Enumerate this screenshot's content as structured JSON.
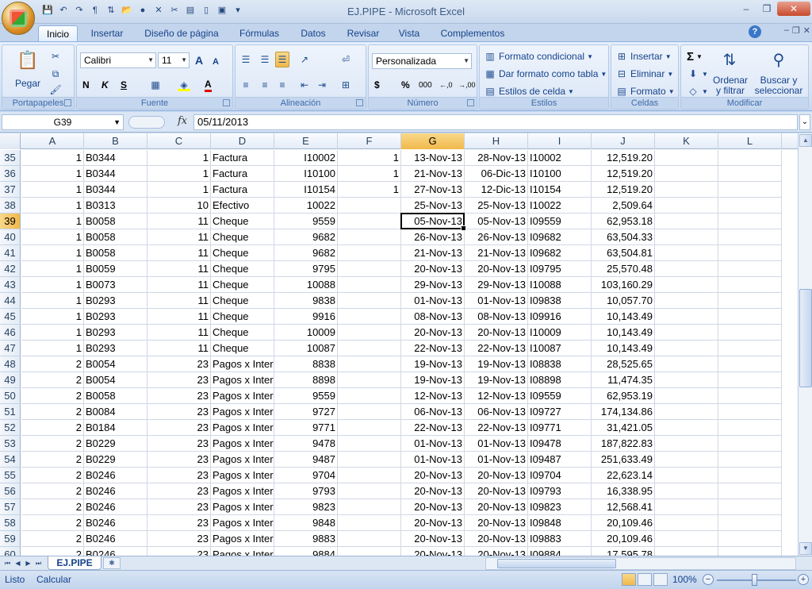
{
  "window": {
    "title": "EJ.PIPE - Microsoft Excel",
    "min": "–",
    "max": "❐",
    "close": "✕"
  },
  "ribbon_tabs": [
    "Inicio",
    "Insertar",
    "Diseño de página",
    "Fórmulas",
    "Datos",
    "Revisar",
    "Vista",
    "Complementos"
  ],
  "ribbon": {
    "clipboard": {
      "label": "Portapapeles",
      "paste": "Pegar"
    },
    "font": {
      "label": "Fuente",
      "name": "Calibri",
      "size": "11",
      "bold": "N",
      "italic": "K",
      "underline": "S",
      "grow": "A",
      "shrink": "A",
      "font_color": "A"
    },
    "alignment": {
      "label": "Alineación"
    },
    "number": {
      "label": "Número",
      "format": "Personalizada",
      "currency": "$",
      "percent": "%",
      "thousands": "000",
      "inc_dec": "←,0",
      "dec_dec": "→,00"
    },
    "styles": {
      "label": "Estilos",
      "conditional": "Formato condicional",
      "as_table": "Dar formato como tabla",
      "cell_styles": "Estilos de celda"
    },
    "cells": {
      "label": "Celdas",
      "insert": "Insertar",
      "delete": "Eliminar",
      "format": "Formato"
    },
    "editing": {
      "label": "Modificar",
      "sum": "Σ",
      "sort_line1": "Ordenar",
      "sort_line2": "y filtrar",
      "find_line1": "Buscar y",
      "find_line2": "seleccionar"
    }
  },
  "formula_bar": {
    "name_box": "G39",
    "fx": "fx",
    "formula": "05/11/2013"
  },
  "columns": [
    "A",
    "B",
    "C",
    "D",
    "E",
    "F",
    "G",
    "H",
    "I",
    "J",
    "K",
    "L"
  ],
  "selected_column": "G",
  "selected_row": "39",
  "rows": [
    {
      "n": "35",
      "A": "1",
      "B": "B0344",
      "C": "1",
      "D": "Factura",
      "E": "I10002",
      "F": "1",
      "G": "13-Nov-13",
      "H": "28-Nov-13",
      "I": "I10002",
      "J": "12,519.20"
    },
    {
      "n": "36",
      "A": "1",
      "B": "B0344",
      "C": "1",
      "D": "Factura",
      "E": "I10100",
      "F": "1",
      "G": "21-Nov-13",
      "H": "06-Dic-13",
      "I": "I10100",
      "J": "12,519.20"
    },
    {
      "n": "37",
      "A": "1",
      "B": "B0344",
      "C": "1",
      "D": "Factura",
      "E": "I10154",
      "F": "1",
      "G": "27-Nov-13",
      "H": "12-Dic-13",
      "I": "I10154",
      "J": "12,519.20"
    },
    {
      "n": "38",
      "A": "1",
      "B": "B0313",
      "C": "10",
      "D": "Efectivo",
      "E": "10022",
      "F": "",
      "G": "25-Nov-13",
      "H": "25-Nov-13",
      "I": "I10022",
      "J": "2,509.64"
    },
    {
      "n": "39",
      "A": "1",
      "B": "B0058",
      "C": "11",
      "D": "Cheque",
      "E": "9559",
      "F": "",
      "G": "05-Nov-13",
      "H": "05-Nov-13",
      "I": "I09559",
      "J": "62,953.18"
    },
    {
      "n": "40",
      "A": "1",
      "B": "B0058",
      "C": "11",
      "D": "Cheque",
      "E": "9682",
      "F": "",
      "G": "26-Nov-13",
      "H": "26-Nov-13",
      "I": "I09682",
      "J": "63,504.33"
    },
    {
      "n": "41",
      "A": "1",
      "B": "B0058",
      "C": "11",
      "D": "Cheque",
      "E": "9682",
      "F": "",
      "G": "21-Nov-13",
      "H": "21-Nov-13",
      "I": "I09682",
      "J": "63,504.81"
    },
    {
      "n": "42",
      "A": "1",
      "B": "B0059",
      "C": "11",
      "D": "Cheque",
      "E": "9795",
      "F": "",
      "G": "20-Nov-13",
      "H": "20-Nov-13",
      "I": "I09795",
      "J": "25,570.48"
    },
    {
      "n": "43",
      "A": "1",
      "B": "B0073",
      "C": "11",
      "D": "Cheque",
      "E": "10088",
      "F": "",
      "G": "29-Nov-13",
      "H": "29-Nov-13",
      "I": "I10088",
      "J": "103,160.29"
    },
    {
      "n": "44",
      "A": "1",
      "B": "B0293",
      "C": "11",
      "D": "Cheque",
      "E": "9838",
      "F": "",
      "G": "01-Nov-13",
      "H": "01-Nov-13",
      "I": "I09838",
      "J": "10,057.70"
    },
    {
      "n": "45",
      "A": "1",
      "B": "B0293",
      "C": "11",
      "D": "Cheque",
      "E": "9916",
      "F": "",
      "G": "08-Nov-13",
      "H": "08-Nov-13",
      "I": "I09916",
      "J": "10,143.49"
    },
    {
      "n": "46",
      "A": "1",
      "B": "B0293",
      "C": "11",
      "D": "Cheque",
      "E": "10009",
      "F": "",
      "G": "20-Nov-13",
      "H": "20-Nov-13",
      "I": "I10009",
      "J": "10,143.49"
    },
    {
      "n": "47",
      "A": "1",
      "B": "B0293",
      "C": "11",
      "D": "Cheque",
      "E": "10087",
      "F": "",
      "G": "22-Nov-13",
      "H": "22-Nov-13",
      "I": "I10087",
      "J": "10,143.49"
    },
    {
      "n": "48",
      "A": "2",
      "B": "B0054",
      "C": "23",
      "D": "Pagos x Inter",
      "E": "8838",
      "F": "",
      "G": "19-Nov-13",
      "H": "19-Nov-13",
      "I": "I08838",
      "J": "28,525.65"
    },
    {
      "n": "49",
      "A": "2",
      "B": "B0054",
      "C": "23",
      "D": "Pagos x Inter",
      "E": "8898",
      "F": "",
      "G": "19-Nov-13",
      "H": "19-Nov-13",
      "I": "I08898",
      "J": "11,474.35"
    },
    {
      "n": "50",
      "A": "2",
      "B": "B0058",
      "C": "23",
      "D": "Pagos x Inter",
      "E": "9559",
      "F": "",
      "G": "12-Nov-13",
      "H": "12-Nov-13",
      "I": "I09559",
      "J": "62,953.19"
    },
    {
      "n": "51",
      "A": "2",
      "B": "B0084",
      "C": "23",
      "D": "Pagos x Inter",
      "E": "9727",
      "F": "",
      "G": "06-Nov-13",
      "H": "06-Nov-13",
      "I": "I09727",
      "J": "174,134.86"
    },
    {
      "n": "52",
      "A": "2",
      "B": "B0184",
      "C": "23",
      "D": "Pagos x Inter",
      "E": "9771",
      "F": "",
      "G": "22-Nov-13",
      "H": "22-Nov-13",
      "I": "I09771",
      "J": "31,421.05"
    },
    {
      "n": "53",
      "A": "2",
      "B": "B0229",
      "C": "23",
      "D": "Pagos x Inter",
      "E": "9478",
      "F": "",
      "G": "01-Nov-13",
      "H": "01-Nov-13",
      "I": "I09478",
      "J": "187,822.83"
    },
    {
      "n": "54",
      "A": "2",
      "B": "B0229",
      "C": "23",
      "D": "Pagos x Inter",
      "E": "9487",
      "F": "",
      "G": "01-Nov-13",
      "H": "01-Nov-13",
      "I": "I09487",
      "J": "251,633.49"
    },
    {
      "n": "55",
      "A": "2",
      "B": "B0246",
      "C": "23",
      "D": "Pagos x Inter",
      "E": "9704",
      "F": "",
      "G": "20-Nov-13",
      "H": "20-Nov-13",
      "I": "I09704",
      "J": "22,623.14"
    },
    {
      "n": "56",
      "A": "2",
      "B": "B0246",
      "C": "23",
      "D": "Pagos x Inter",
      "E": "9793",
      "F": "",
      "G": "20-Nov-13",
      "H": "20-Nov-13",
      "I": "I09793",
      "J": "16,338.95"
    },
    {
      "n": "57",
      "A": "2",
      "B": "B0246",
      "C": "23",
      "D": "Pagos x Inter",
      "E": "9823",
      "F": "",
      "G": "20-Nov-13",
      "H": "20-Nov-13",
      "I": "I09823",
      "J": "12,568.41"
    },
    {
      "n": "58",
      "A": "2",
      "B": "B0246",
      "C": "23",
      "D": "Pagos x Inter",
      "E": "9848",
      "F": "",
      "G": "20-Nov-13",
      "H": "20-Nov-13",
      "I": "I09848",
      "J": "20,109.46"
    },
    {
      "n": "59",
      "A": "2",
      "B": "B0246",
      "C": "23",
      "D": "Pagos x Inter",
      "E": "9883",
      "F": "",
      "G": "20-Nov-13",
      "H": "20-Nov-13",
      "I": "I09883",
      "J": "20,109.46"
    },
    {
      "n": "60",
      "A": "2",
      "B": "B0246",
      "C": "23",
      "D": "Pagos x Inter",
      "E": "9884",
      "F": "",
      "G": "20-Nov-13",
      "H": "20-Nov-13",
      "I": "I09884",
      "J": "17,595.78"
    }
  ],
  "sheet": {
    "name": "EJ.PIPE"
  },
  "status": {
    "ready": "Listo",
    "calc": "Calcular",
    "zoom": "100%"
  },
  "colors": {
    "accent": "#f1b84a",
    "ribbon_text": "#15428b",
    "grid_line": "#d0d7e5"
  }
}
